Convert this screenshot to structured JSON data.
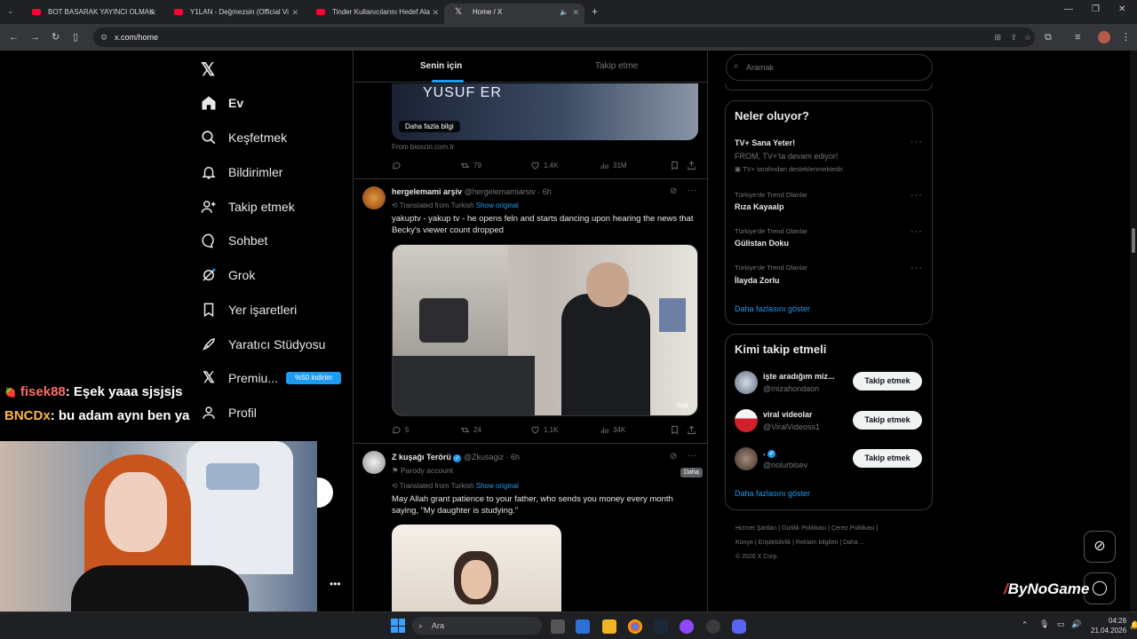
{
  "browser": {
    "tabs": [
      "BOT BASARAK YAYINCI OLMAK",
      "Y1LAN - Değmezsin (Official Vi",
      "Tinder Kullanıcılarını Hedef Ala",
      "Home / X"
    ],
    "url": "x.com/home"
  },
  "nav": {
    "items": [
      "Ev",
      "Keşfetmek",
      "Bildirimler",
      "Takip etmek",
      "Sohbet",
      "Grok",
      "Yer işaretleri",
      "Yaratıcı Stüdyosu",
      "Premiu...",
      "Profil"
    ],
    "premium_badge": "%50 indirim"
  },
  "chat": [
    {
      "user": "fisek88",
      "text": ": Eşek yaaa sjsjsjs"
    },
    {
      "user": "BNCDx",
      "text": ": bu adam aynı ben ya"
    }
  ],
  "feed": {
    "tabs": [
      "Senin için",
      "Takip etme"
    ],
    "top_card": {
      "video_text": "YUSUF ER",
      "cta": "Daha fazla bilgi",
      "source": "From bioxcin.com.tr",
      "stats": [
        "",
        "79",
        "1,4K",
        "31M"
      ]
    },
    "post1": {
      "name": "hergelemami arşiv",
      "handle": "@hergelemamiarsiv · 6h",
      "translated": "Translated from Turkish",
      "show_original": "Show original",
      "text": "yakuptv - yakup tv - he opens feln and starts dancing upon hearing the news that Becky's viewer count dropped",
      "media_tag": "logi",
      "stats": [
        "5",
        "24",
        "1,1K",
        "34K"
      ]
    },
    "post2": {
      "name": "Z kuşağı Terörü",
      "handle": "@Zkusagiz · 6h",
      "label": "Parody account",
      "translated": "Translated from Turkish",
      "show_original": "Show original",
      "text": "May Allah grant patience to your father, who sends you money every month saying, “My daughter is studying.”",
      "tooltip": "Daha"
    }
  },
  "sidebar": {
    "search_placeholder": "Aramak",
    "whats_happening": "Neler oluyor?",
    "trends": [
      {
        "title": "TV+ Sana Yeter!",
        "sub": "FROM, TV+'ta devam ediyor!",
        "promo": "TV+ tarafından desteklenmektedir."
      },
      {
        "context": "Türkiye'de Trend Olanlar",
        "title": "Rıza Kayaalp"
      },
      {
        "context": "Türkiye'de Trend Olanlar",
        "title": "Gülistan Doku"
      },
      {
        "context": "Türkiye'de Trend Olanlar",
        "title": "İlayda Zorlu"
      }
    ],
    "show_more": "Daha fazlasını göster",
    "who_to_follow": "Kimi takip etmeli",
    "follow": [
      {
        "name": "işte aradığım miz...",
        "handle": "@mizahondaon",
        "button": "Takip etmek"
      },
      {
        "name": "viral videolar",
        "handle": "@ViralVideoss1",
        "button": "Takip etmek"
      },
      {
        "name": ".",
        "handle": "@nolurbisev",
        "button": "Takip etmek"
      }
    ],
    "show_more2": "Daha fazlasını göster",
    "footer": [
      "Hizmet Şartları",
      "|",
      "Gizlilik Politikası",
      "|",
      "Çerez Politikası",
      "|",
      "Künye",
      "|",
      "Erişilebilirlik",
      "|",
      "Reklam bilgileri",
      "|",
      "Daha ...",
      "© 2026 X Corp."
    ]
  },
  "watermark": "ByNoGame",
  "taskbar": {
    "search": "Ara",
    "time": "04:28",
    "date": "21.04.2026"
  }
}
